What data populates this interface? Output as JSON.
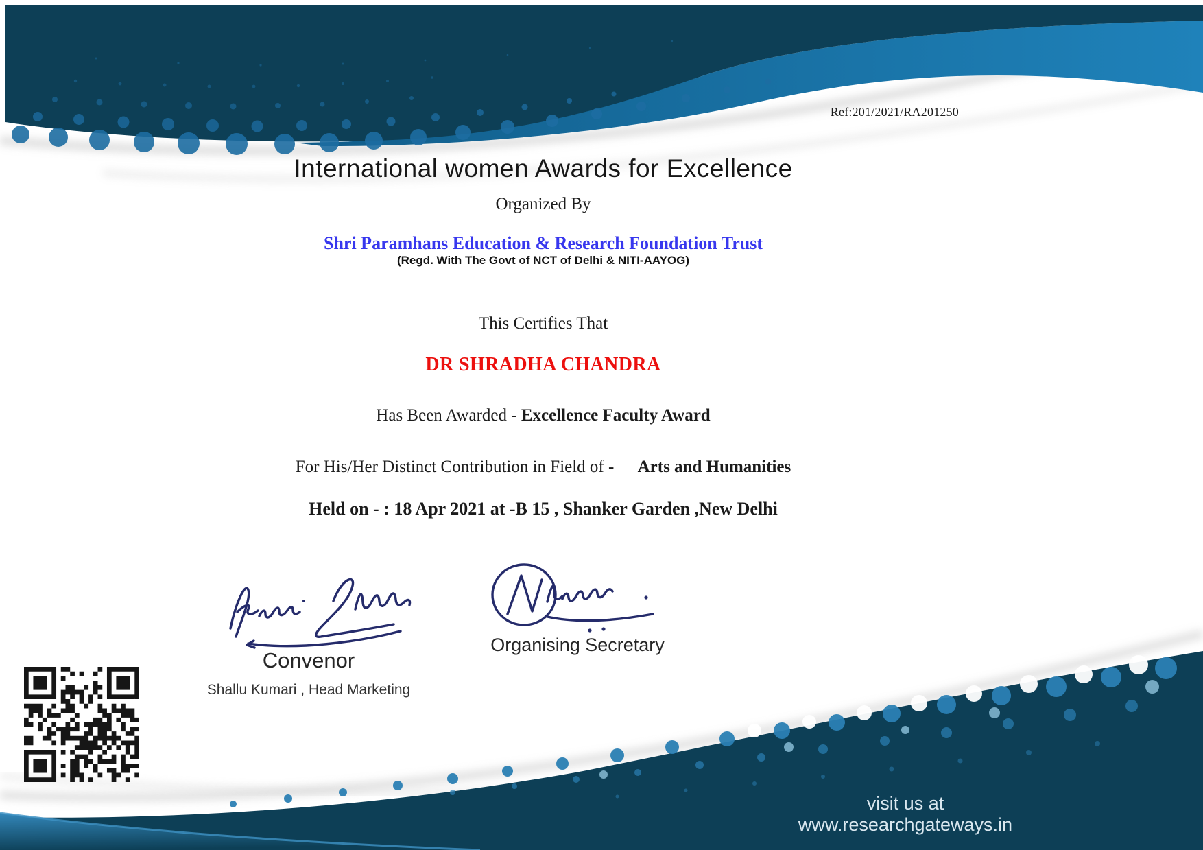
{
  "certificate": {
    "ref": "Ref:201/2021/RA201250",
    "title": "International women Awards for Excellence",
    "organized_by": "Organized By",
    "organization": "Shri Paramhans Education & Research Foundation Trust",
    "registration": "(Regd. With The Govt of NCT of Delhi & NITI-AAYOG)",
    "certifies_label": "This Certifies That",
    "recipient": "DR SHRADHA CHANDRA",
    "awarded_prefix": "Has Been Awarded -",
    "award": "Excellence Faculty Award",
    "field_prefix": "For His/Her Distinct Contribution in Field of -",
    "field": "Arts and Humanities",
    "event_details": "Held on - : 18 Apr 2021 at -B 15 , Shanker Garden ,New Delhi",
    "signatories": {
      "left": {
        "title": "Convenor",
        "name": "Shallu Kumari , Head Marketing"
      },
      "right": {
        "title": "Organising Secretary"
      }
    },
    "footer": {
      "website_note": "visit us at www.researchgateways.in"
    },
    "colors": {
      "band_dark": "#0d3f56",
      "band_blue": "#1f82ba",
      "halftone_dot": "#1d6da2",
      "organization_text": "#3737ee",
      "recipient_text": "#ec100e",
      "signature_ink": "#252b6b",
      "footer_text": "#d9e7ef"
    }
  }
}
